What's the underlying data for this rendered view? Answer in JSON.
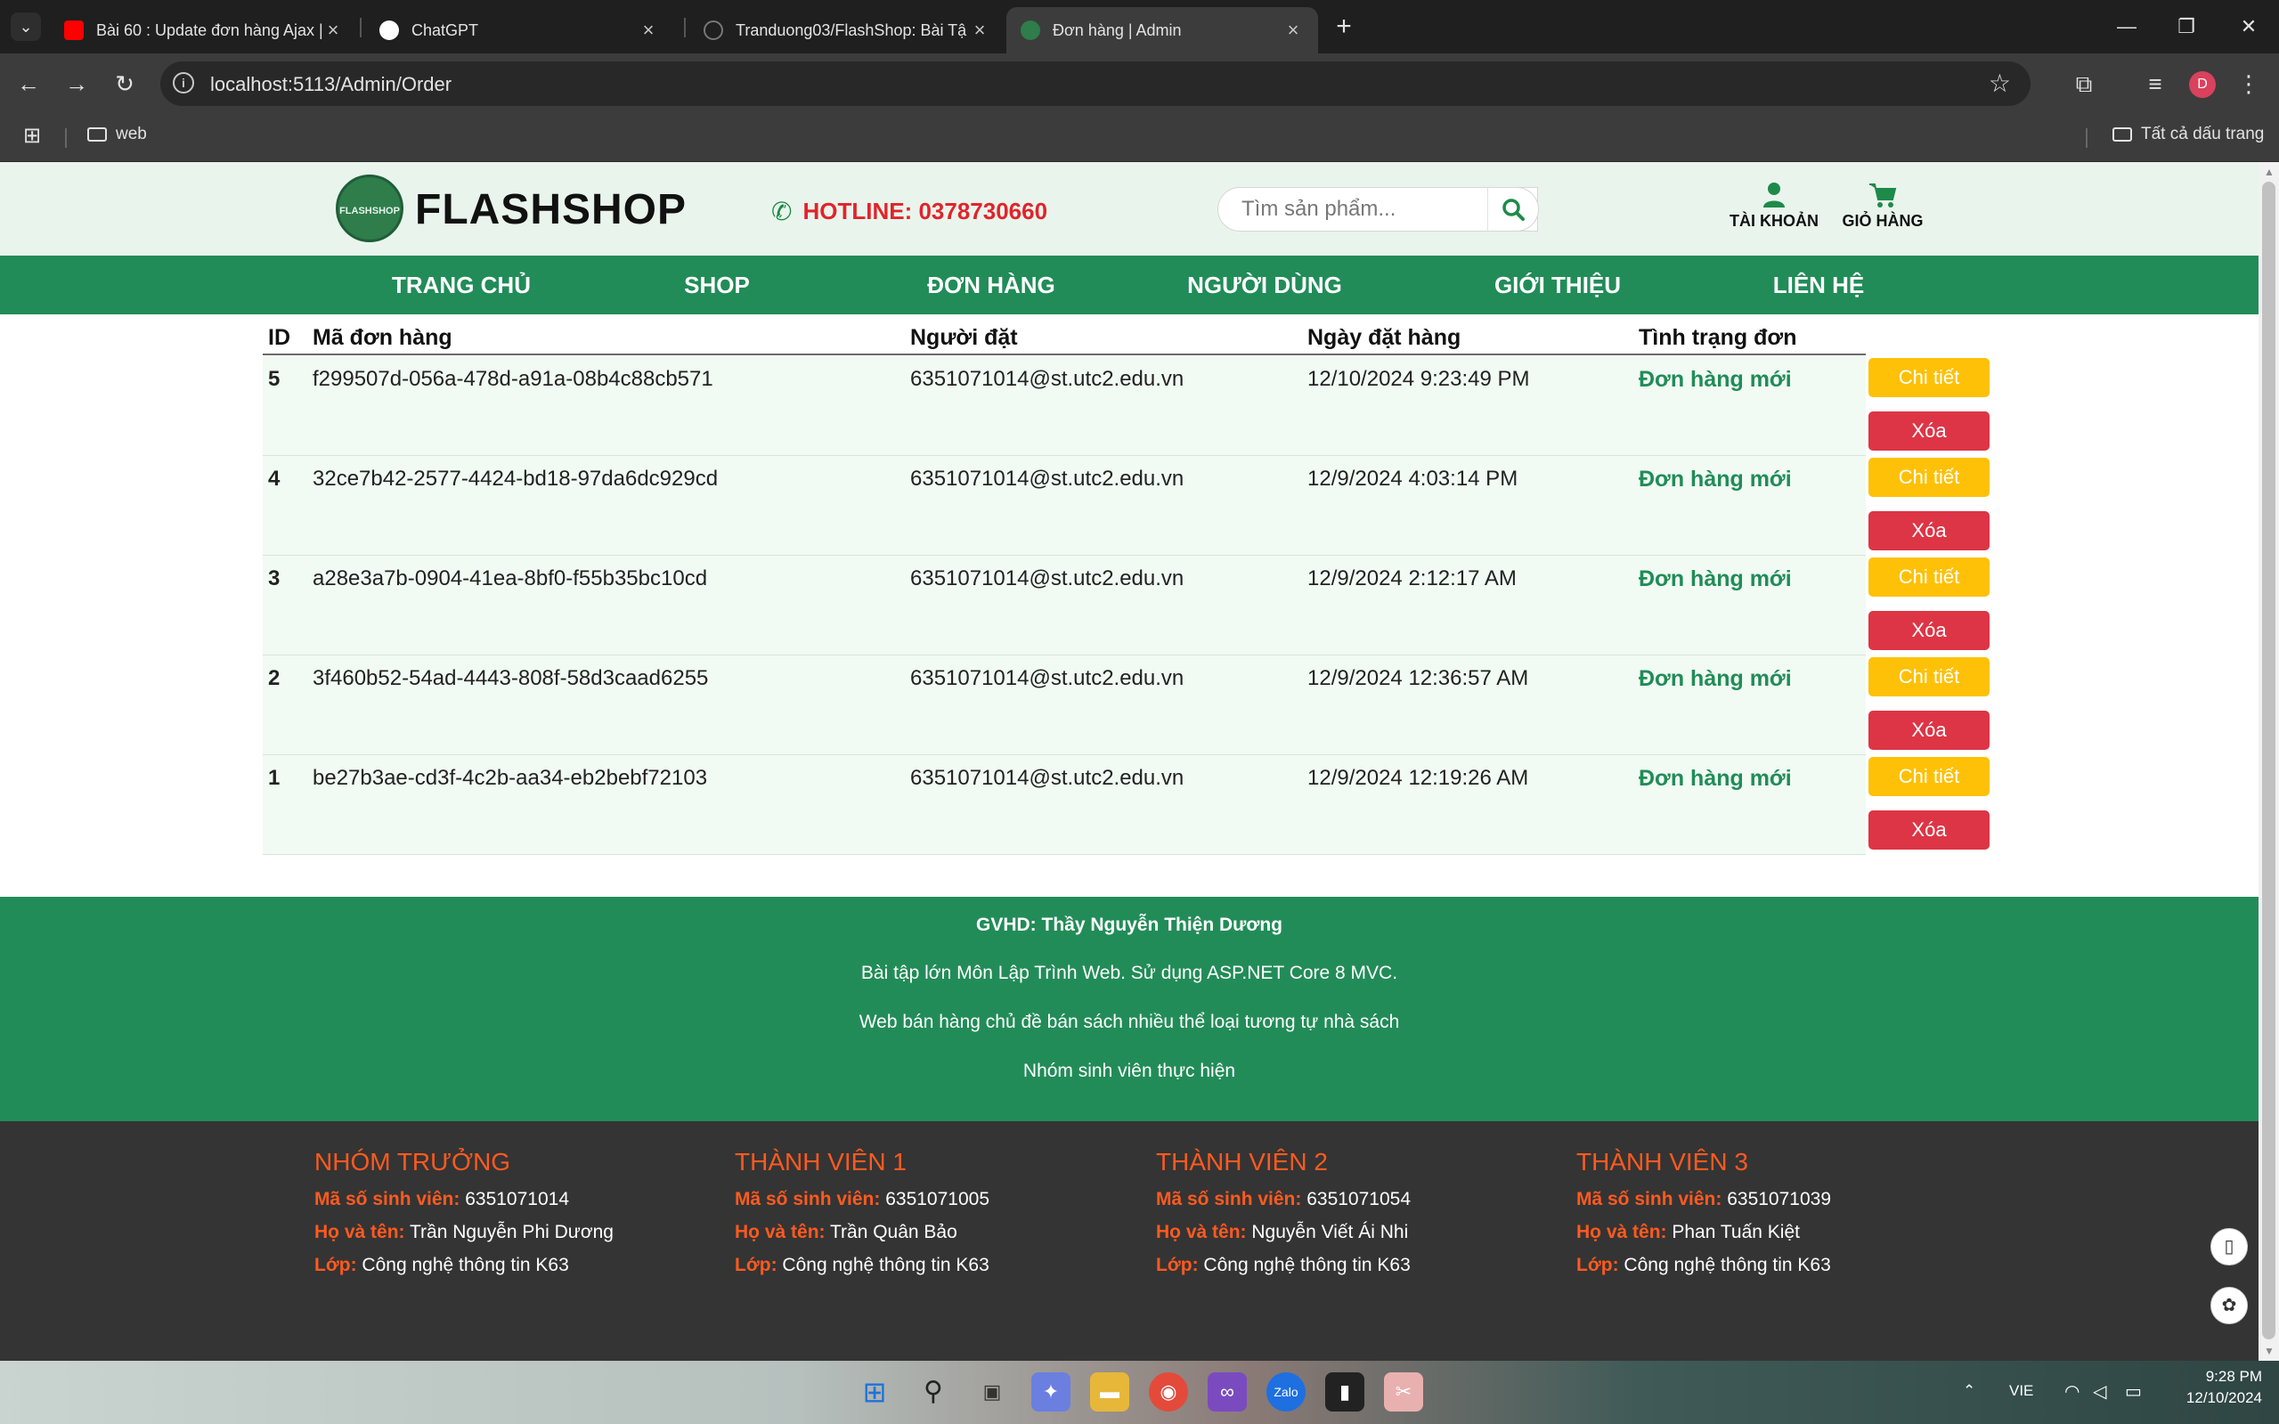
{
  "browser": {
    "tabs": [
      {
        "title": "Bài 60 : Update đơn hàng Ajax |",
        "favicon_color": "#ff0000"
      },
      {
        "title": "ChatGPT",
        "favicon_color": "#ffffff"
      },
      {
        "title": "Tranduong03/FlashShop: Bài Tậ",
        "favicon_color": "#1f1f1f"
      },
      {
        "title": "Đơn hàng | Admin",
        "favicon_color": "#2e7d4b"
      }
    ],
    "url": "localhost:5113/Admin/Order",
    "profile_initial": "D",
    "bookmarks": {
      "folder": "web",
      "all_bookmarks": "Tất cả dấu trang"
    }
  },
  "site": {
    "logo_text": "FLASHSHOP",
    "brand": "FLASHSHOP",
    "hotline": "HOTLINE: 0378730660",
    "search_placeholder": "Tìm sản phẩm...",
    "account_label": "TÀI KHOẢN",
    "cart_label": "GIỎ HÀNG",
    "nav": [
      "TRANG CHỦ",
      "SHOP",
      "ĐƠN HÀNG",
      "NGƯỜI DÙNG",
      "GIỚI THIỆU",
      "LIÊN HỆ"
    ]
  },
  "orders": {
    "headers": {
      "id": "ID",
      "code": "Mã đơn hàng",
      "user": "Người đặt",
      "date": "Ngày đặt hàng",
      "status": "Tình trạng đơn"
    },
    "detail_label": "Chi tiết",
    "delete_label": "Xóa",
    "rows": [
      {
        "id": "5",
        "code": "f299507d-056a-478d-a91a-08b4c88cb571",
        "user": "6351071014@st.utc2.edu.vn",
        "date": "12/10/2024 9:23:49 PM",
        "status": "Đơn hàng mới"
      },
      {
        "id": "4",
        "code": "32ce7b42-2577-4424-bd18-97da6dc929cd",
        "user": "6351071014@st.utc2.edu.vn",
        "date": "12/9/2024 4:03:14 PM",
        "status": "Đơn hàng mới"
      },
      {
        "id": "3",
        "code": "a28e3a7b-0904-41ea-8bf0-f55b35bc10cd",
        "user": "6351071014@st.utc2.edu.vn",
        "date": "12/9/2024 2:12:17 AM",
        "status": "Đơn hàng mới"
      },
      {
        "id": "2",
        "code": "3f460b52-54ad-4443-808f-58d3caad6255",
        "user": "6351071014@st.utc2.edu.vn",
        "date": "12/9/2024 12:36:57 AM",
        "status": "Đơn hàng mới"
      },
      {
        "id": "1",
        "code": "be27b3ae-cd3f-4c2b-aa34-eb2bebf72103",
        "user": "6351071014@st.utc2.edu.vn",
        "date": "12/9/2024 12:19:26 AM",
        "status": "Đơn hàng mới"
      }
    ]
  },
  "footer": {
    "advisor": "GVHD: Thầy Nguyễn Thiện Dương",
    "line1": "Bài tập lớn Môn Lập Trình Web. Sử dụng ASP.NET Core 8 MVC.",
    "line2": "Web bán hàng chủ đề bán sách nhiều thể loại tương tự nhà sách",
    "line3": "Nhóm sinh viên thực hiện",
    "labels": {
      "mssv": "Mã số sinh viên:",
      "name": "Họ và tên:",
      "class": "Lớp:"
    },
    "members": [
      {
        "role": "NHÓM TRƯỞNG",
        "mssv": "6351071014",
        "name": "Trần Nguyễn Phi Dương",
        "class": "Công nghệ thông tin K63"
      },
      {
        "role": "THÀNH VIÊN 1",
        "mssv": "6351071005",
        "name": "Trần Quân Bảo",
        "class": "Công nghệ thông tin K63"
      },
      {
        "role": "THÀNH VIÊN 2",
        "mssv": "6351071054",
        "name": "Nguyễn Viết Ái Nhi",
        "class": "Công nghệ thông tin K63"
      },
      {
        "role": "THÀNH VIÊN 3",
        "mssv": "6351071039",
        "name": "Phan Tuấn Kiệt",
        "class": "Công nghệ thông tin K63"
      }
    ]
  },
  "taskbar": {
    "lang": "VIE",
    "time": "9:28 PM",
    "date": "12/10/2024"
  },
  "colors": {
    "brand_green": "#218c58",
    "hotline_red": "#e0242b",
    "detail_yellow": "#fec107",
    "delete_red": "#dd3545",
    "member_orange": "#ff5a1f"
  }
}
